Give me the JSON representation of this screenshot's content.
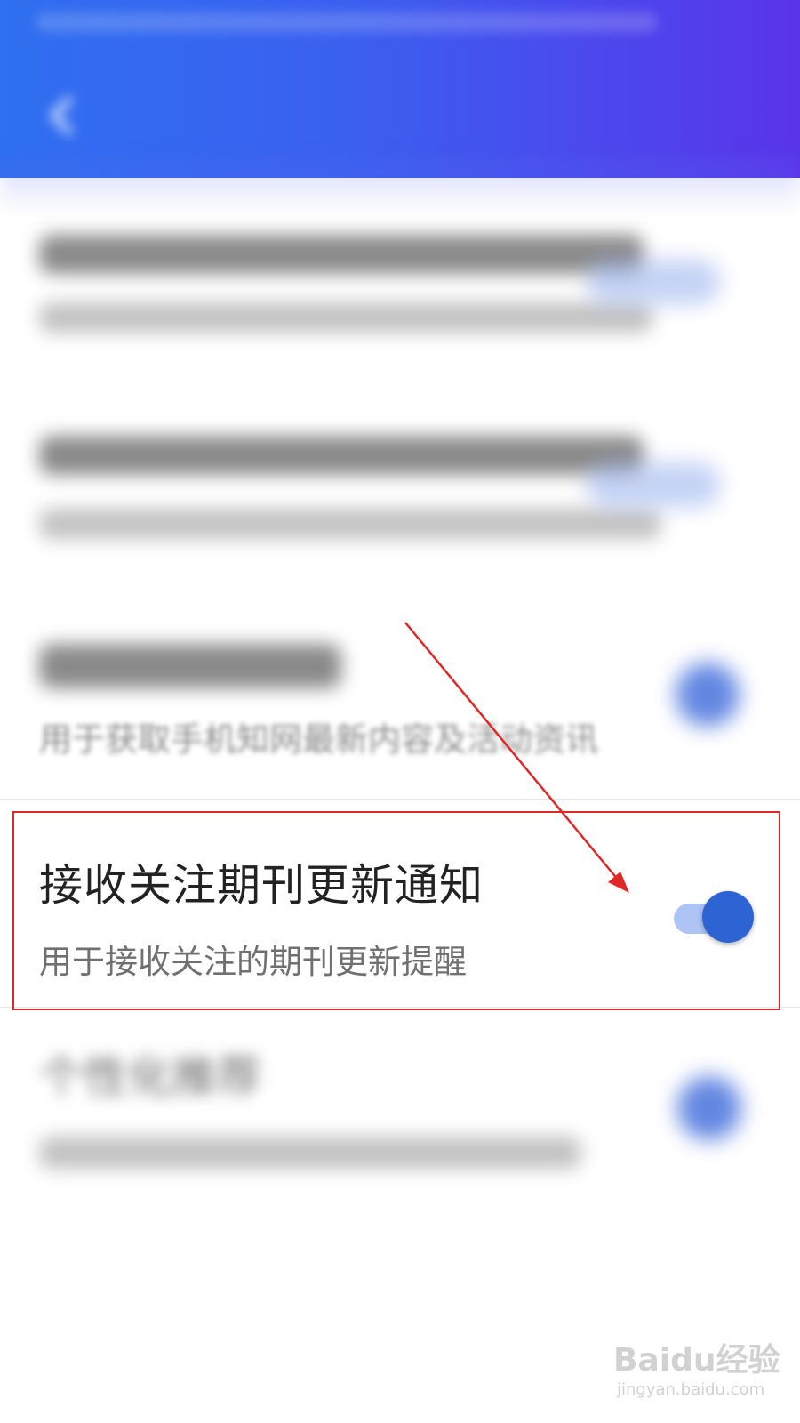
{
  "header": {
    "title": "",
    "background_start": "#2f6ff0",
    "background_end": "#5a34ea",
    "back_icon": "chevron-left-icon"
  },
  "settings": {
    "partial_row_desc": "用于获取手机知网最新内容及活动资讯",
    "focused_item": {
      "title": "接收关注期刊更新通知",
      "description": "用于接收关注的期刊更新提醒",
      "toggle_state": "on",
      "toggle_color": "#2d63d3"
    },
    "partial_row_title": "个性化推荐"
  },
  "annotation": {
    "box_color": "#e02828",
    "arrow_color": "#e02828"
  },
  "watermark": {
    "logo": "Baidu经验",
    "url": "jingyan.baidu.com"
  }
}
